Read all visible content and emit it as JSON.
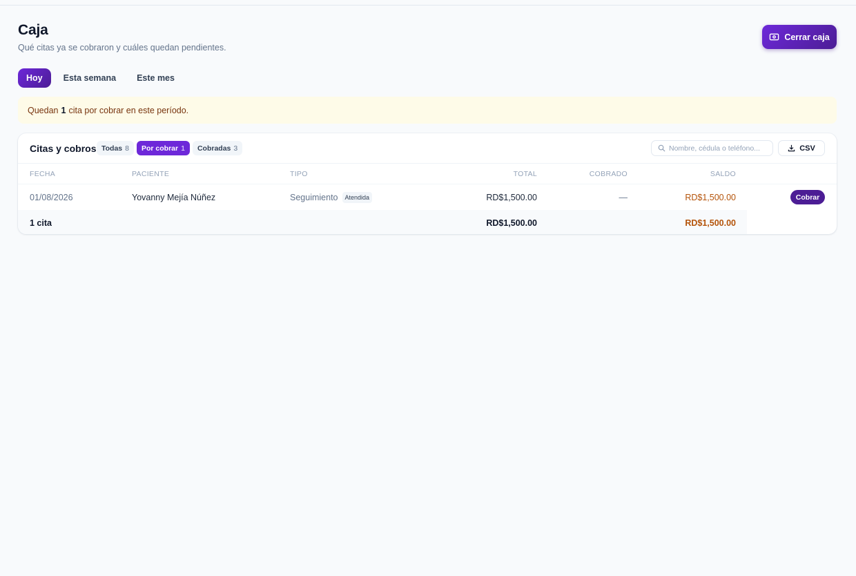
{
  "header": {
    "title": "Caja",
    "subtitle": "Qué citas ya se cobraron y cuáles quedan pendientes.",
    "close_button_label": "Cerrar caja"
  },
  "period_tabs": [
    {
      "label": "Hoy",
      "active": true
    },
    {
      "label": "Esta semana",
      "active": false
    },
    {
      "label": "Este mes",
      "active": false
    }
  ],
  "notice": {
    "prefix": "Quedan",
    "count": "1",
    "suffix": "cita por cobrar en este período."
  },
  "table_card": {
    "title": "Citas y cobros",
    "filters": [
      {
        "label": "Todas",
        "count": "8",
        "active": false
      },
      {
        "label": "Por cobrar",
        "count": "1",
        "active": true
      },
      {
        "label": "Cobradas",
        "count": "3",
        "active": false
      }
    ],
    "search_placeholder": "Nombre, cédula o teléfono...",
    "export_label": "CSV",
    "columns": [
      "FECHA",
      "PACIENTE",
      "TIPO",
      "TOTAL",
      "COBRADO",
      "SALDO"
    ],
    "rows": [
      {
        "date": "01/08/2026",
        "patient": "Yovanny Mejía Núñez",
        "type": "Seguimiento",
        "status": "Atendida",
        "total": "RD$1,500.00",
        "paid": "—",
        "balance": "RD$1,500.00",
        "action": "Cobrar"
      }
    ],
    "footer": {
      "count_label": "1 cita",
      "total": "RD$1,500.00",
      "balance": "RD$1,500.00"
    }
  },
  "colors": {
    "accent": "#6d28d9",
    "accent_dark": "#4c1d95",
    "balance": "#b45309",
    "notice_bg": "#fefbe8"
  }
}
